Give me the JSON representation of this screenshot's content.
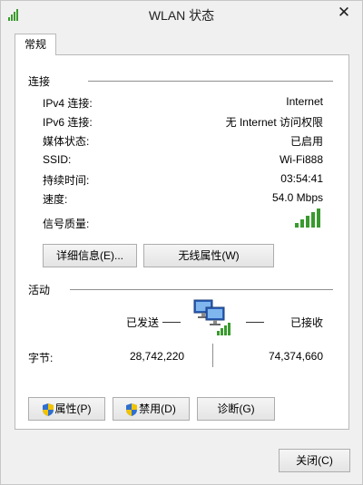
{
  "window": {
    "title": "WLAN 状态",
    "icons": {
      "app": "wifi-signal-icon",
      "close": "close-icon"
    }
  },
  "tab": {
    "label": "常规"
  },
  "connection": {
    "section_title": "连接",
    "rows": [
      {
        "label": "IPv4 连接:",
        "value": "Internet"
      },
      {
        "label": "IPv6 连接:",
        "value": "无 Internet 访问权限"
      },
      {
        "label": "媒体状态:",
        "value": "已启用"
      },
      {
        "label": "SSID:",
        "value": "Wi-Fi888"
      },
      {
        "label": "持续时间:",
        "value": "03:54:41"
      },
      {
        "label": "速度:",
        "value": "54.0 Mbps"
      },
      {
        "label": "信号质量:",
        "value_icon": "signal-strength-icon"
      }
    ],
    "details_button": "详细信息(E)...",
    "wireless_props_button": "无线属性(W)"
  },
  "activity": {
    "section_title": "活动",
    "sent_label": "已发送",
    "received_label": "已接收",
    "bytes_label": "字节:",
    "bytes_sent": "28,742,220",
    "bytes_received": "74,374,660",
    "network_icon": "network-computers-icon"
  },
  "actions": {
    "properties_button": "属性(P)",
    "disable_button": "禁用(D)",
    "diagnose_button": "诊断(G)",
    "shield_icon": "uac-shield-icon"
  },
  "footer": {
    "close_button": "关闭(C)"
  },
  "colors": {
    "signal_green": "#3a9a2e",
    "panel_bg": "#ffffff",
    "window_bg": "#f0f0f0"
  }
}
